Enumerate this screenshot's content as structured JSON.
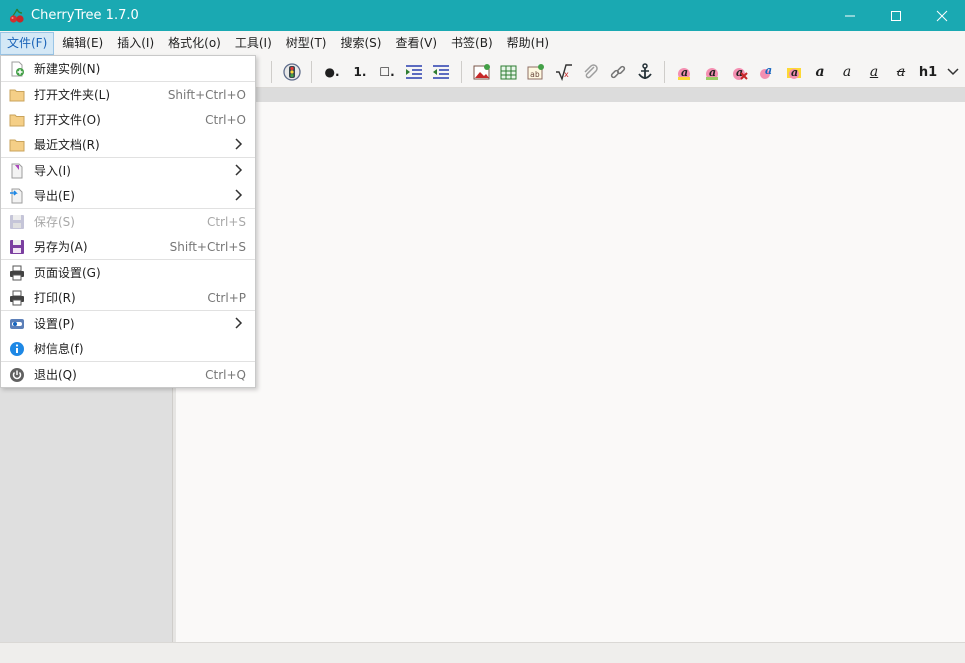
{
  "window": {
    "title": "CherryTree 1.7.0",
    "icon": "cherry-icon"
  },
  "menubar": {
    "items": [
      {
        "label": "文件(F)",
        "active": true
      },
      {
        "label": "编辑(E)"
      },
      {
        "label": "插入(I)"
      },
      {
        "label": "格式化(o)"
      },
      {
        "label": "工具(I)"
      },
      {
        "label": "树型(T)"
      },
      {
        "label": "搜索(S)"
      },
      {
        "label": "查看(V)"
      },
      {
        "label": "书签(B)"
      },
      {
        "label": "帮助(H)"
      }
    ]
  },
  "toolbar": {
    "bullet_label": "●.",
    "numbered_label": "1.",
    "todo_label": "☐.",
    "h1_label": "h1",
    "format_a": "a"
  },
  "file_menu": {
    "items": [
      {
        "label": "新建实例(N)",
        "accel": "",
        "icon": "new-instance-icon"
      },
      {
        "label": "打开文件夹(L)",
        "accel": "Shift+Ctrl+O",
        "icon": "folder-icon"
      },
      {
        "label": "打开文件(O)",
        "accel": "Ctrl+O",
        "icon": "folder-icon"
      },
      {
        "label": "最近文档(R)",
        "accel": "",
        "icon": "folder-icon",
        "submenu": true
      },
      {
        "label": "导入(I)",
        "accel": "",
        "icon": "import-icon",
        "submenu": true
      },
      {
        "label": "导出(E)",
        "accel": "",
        "icon": "export-icon",
        "submenu": true
      },
      {
        "label": "保存(S)",
        "accel": "Ctrl+S",
        "icon": "save-icon",
        "disabled": true
      },
      {
        "label": "另存为(A)",
        "accel": "Shift+Ctrl+S",
        "icon": "save-as-icon"
      },
      {
        "label": "页面设置(G)",
        "accel": "",
        "icon": "printer-icon"
      },
      {
        "label": "打印(R)",
        "accel": "Ctrl+P",
        "icon": "printer-icon"
      },
      {
        "label": "设置(P)",
        "accel": "",
        "icon": "settings-icon",
        "submenu": true
      },
      {
        "label": "树信息(f)",
        "accel": "",
        "icon": "info-icon"
      },
      {
        "label": "退出(Q)",
        "accel": "Ctrl+Q",
        "icon": "power-icon"
      }
    ]
  },
  "colors": {
    "titlebar": "#1aa9b2",
    "menu_active_bg": "#d4e8f6",
    "left_pane": "#dfdfdf",
    "editor_bg": "#faf9f8"
  }
}
